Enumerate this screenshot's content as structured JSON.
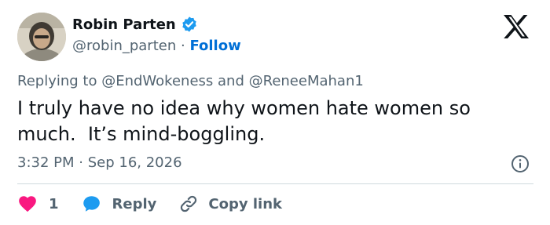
{
  "author": {
    "display_name": "Robin Parten",
    "handle": "@robin_parten",
    "separator": "·",
    "follow_label": "Follow",
    "verified": true
  },
  "reply_context": {
    "prefix": "Replying to",
    "mention_1": "@EndWokeness",
    "conjunction": "and",
    "mention_2": "@ReneeMahan1"
  },
  "tweet": {
    "line_1": "I truly have no idea why women hate women so",
    "line_2": "much.  It’s mind-boggling."
  },
  "meta": {
    "time": "3:32 PM",
    "separator": "·",
    "date": "Sep 16, 2026"
  },
  "actions": {
    "like_count": "1",
    "reply_label": "Reply",
    "copy_label": "Copy link"
  },
  "icons": {
    "logo": "x-logo-icon",
    "verified": "verified-badge-icon",
    "info": "info-icon",
    "like": "heart-icon",
    "reply": "reply-bubble-icon",
    "copy": "link-icon"
  },
  "colors": {
    "link_blue": "#006fd6",
    "verified_blue": "#1d9bf0",
    "like_red": "#f91880",
    "secondary_text": "#536471",
    "primary_text": "#0f1419",
    "divider": "#cfd9de"
  }
}
